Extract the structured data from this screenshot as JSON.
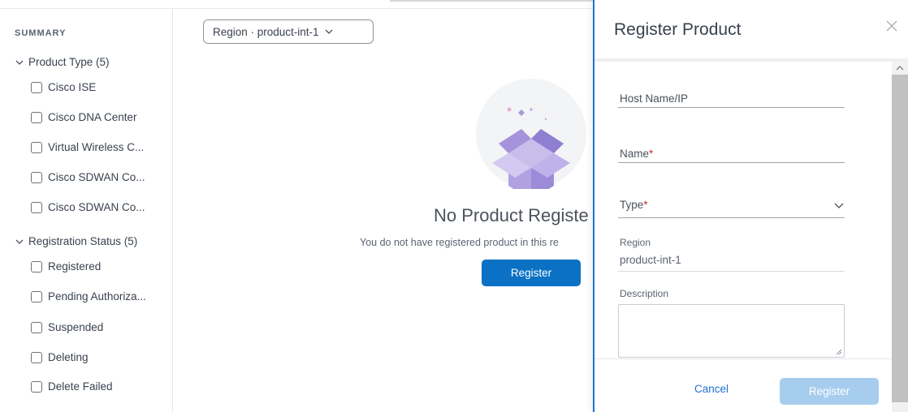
{
  "sidebar": {
    "summary_title": "SUMMARY",
    "product_type": {
      "label": "Product Type (5)",
      "items": [
        "Cisco ISE",
        "Cisco DNA Center",
        "Virtual Wireless C...",
        "Cisco SDWAN Co...",
        "Cisco SDWAN Co..."
      ]
    },
    "registration_status": {
      "label": "Registration Status (5)",
      "items": [
        "Registered",
        "Pending Authoriza...",
        "Suspended",
        "Deleting",
        "Delete Failed"
      ]
    }
  },
  "main": {
    "region_chip": "Region · product-int-1",
    "empty_title": "No Product Registe",
    "empty_subtitle": "You do not have registered product in this re",
    "register_button": "Register"
  },
  "drawer": {
    "title": "Register Product",
    "fields": {
      "host_label": "Host Name/IP",
      "name_label": "Name",
      "type_label": "Type",
      "required_mark": "*",
      "region_label": "Region",
      "region_value": "product-int-1",
      "description_label": "Description"
    },
    "cancel_label": "Cancel",
    "register_label": "Register"
  },
  "colors": {
    "primary": "#0b71c4",
    "primary_disabled": "#a7cdee",
    "drawer_border": "#1f73cf",
    "required": "#cc2d2d"
  }
}
